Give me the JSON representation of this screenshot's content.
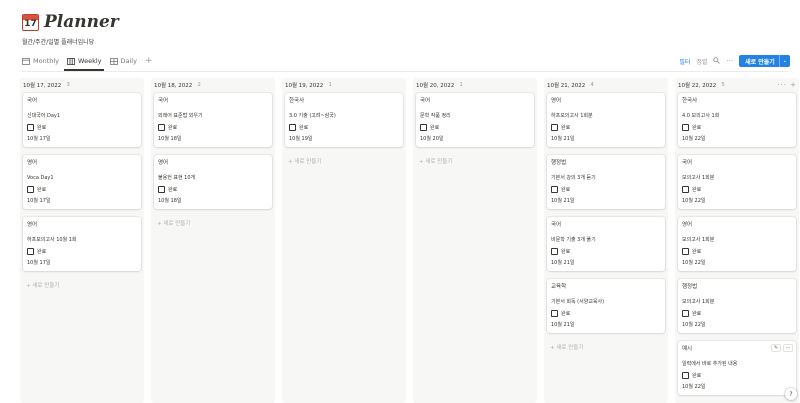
{
  "page": {
    "icon_text": "17",
    "title": "Planner",
    "subtitle": "월간/주간/일별 플래너입니당"
  },
  "views": [
    {
      "label": "Monthly",
      "icon": "calendar-icon"
    },
    {
      "label": "Weekly",
      "icon": "board-icon"
    },
    {
      "label": "Daily",
      "icon": "table-icon"
    }
  ],
  "toolbar": {
    "filter": "필터",
    "sort": "정렬",
    "search_icon": "search-icon",
    "more_icon": "more-icon",
    "new_button": "새로 만들기",
    "new_button_caret": "⌄",
    "add_view": "+"
  },
  "board": {
    "new_label": "+ 새로 만들기",
    "check_label": "완료",
    "columns": [
      {
        "header": "10월 17, 2022",
        "count": "3",
        "cards": [
          {
            "title": "국어",
            "body": "신대국어 Day1",
            "date": "10월 17일"
          },
          {
            "title": "영어",
            "body": "Voca Day1",
            "date": "10월 17일"
          },
          {
            "title": "영어",
            "body": "하프모의고사 10월 1회",
            "date": "10월 17일"
          }
        ]
      },
      {
        "header": "10월 18, 2022",
        "count": "2",
        "cards": [
          {
            "title": "국어",
            "body": "외래어 표준법 외우기",
            "date": "10월 18일"
          },
          {
            "title": "영어",
            "body": "불용헌 표현 10개",
            "date": "10월 18일"
          }
        ]
      },
      {
        "header": "10월 19, 2022",
        "count": "1",
        "cards": [
          {
            "title": "한국사",
            "body": "3.0 기출 (고려~삼국)",
            "date": "10월 19일"
          }
        ]
      },
      {
        "header": "10월 20, 2022",
        "count": "1",
        "cards": [
          {
            "title": "국어",
            "body": "문학 작품 정리",
            "date": "10월 20일"
          }
        ]
      },
      {
        "header": "10월 21, 2022",
        "count": "4",
        "cards": [
          {
            "title": "영어",
            "body": "하프모의고사 1회분",
            "date": "10월 21일"
          },
          {
            "title": "행정법",
            "body": "기본서 강의 3개 듣기",
            "date": "10월 21일"
          },
          {
            "title": "국어",
            "body": "비문학 기출 3개 풀기",
            "date": "10월 21일"
          },
          {
            "title": "교육학",
            "body": "기본서 회독 (서양교육사)",
            "date": "10월 21일"
          }
        ]
      },
      {
        "header": "10월 22, 2022",
        "count": "5",
        "actions": "··· +",
        "cards": [
          {
            "title": "한국사",
            "body": "4.0 모의고사 1회",
            "date": "10월 22일"
          },
          {
            "title": "국어",
            "body": "모의고사 1회분",
            "date": "10월 22일"
          },
          {
            "title": "영어",
            "body": "모의고사 1회분",
            "date": "10월 22일"
          },
          {
            "title": "행정법",
            "body": "모의고사 1회분",
            "date": "10월 22일"
          },
          {
            "title": "예시",
            "body": "일력에서 바로 추가된 내용",
            "date": "10월 22일",
            "tools": [
              "✎",
              "···"
            ]
          }
        ]
      }
    ]
  },
  "help": "?"
}
